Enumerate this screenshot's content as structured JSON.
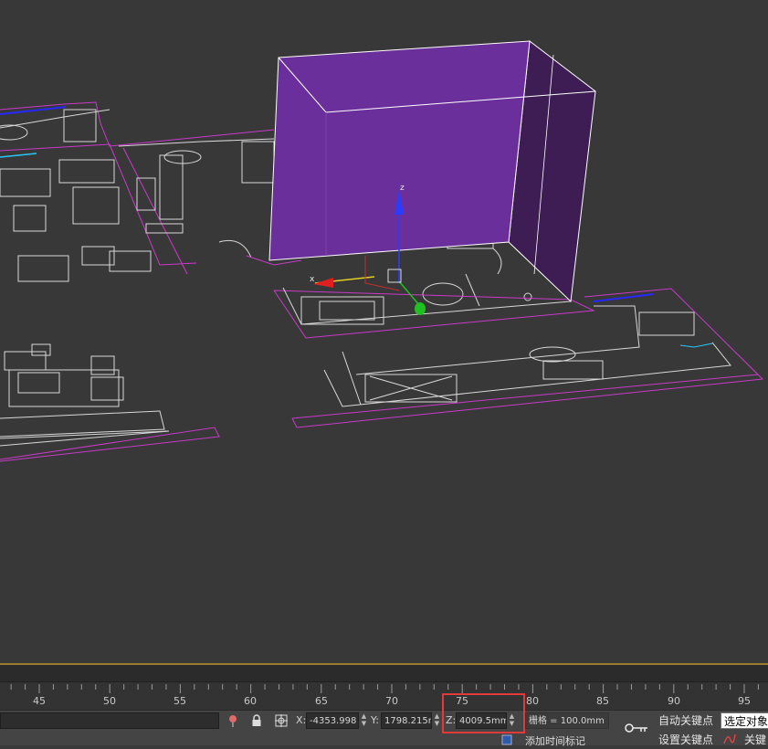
{
  "timeline": {
    "ticks": [
      "45",
      "50",
      "55",
      "60",
      "65",
      "70",
      "75",
      "80",
      "85",
      "90",
      "95"
    ]
  },
  "status": {
    "x_label": "X:",
    "x_value": "-4353.998",
    "y_label": "Y:",
    "y_value": "1798.215m",
    "z_label": "Z:",
    "z_value": "4009.5mm",
    "grid_text": "栅格 = 100.0mm",
    "auto_key": "自动关键点",
    "set_key": "设置关键点",
    "selected_object": "选定对象",
    "add_time_tag": "添加时间标记",
    "key_filters": "关键"
  },
  "viewport": {
    "gizmo_x": "x",
    "gizmo_z": "z"
  },
  "colors": {
    "box_front": "#6a2f9a",
    "box_side": "#3e1d55",
    "wire": "#d23bd2",
    "highlight": "#e03a3a"
  }
}
